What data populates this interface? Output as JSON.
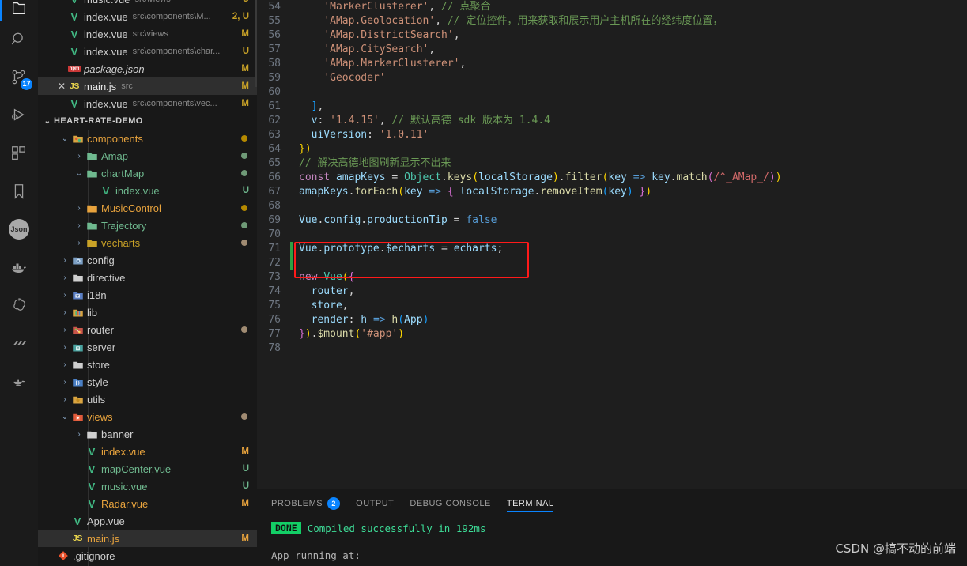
{
  "activitybar": {
    "items": [
      {
        "name": "explorer-icon",
        "label": "Explorer",
        "active": true
      },
      {
        "name": "search-icon",
        "label": "Search"
      },
      {
        "name": "source-control-icon",
        "label": "Source Control",
        "badge": "17"
      },
      {
        "name": "run-debug-icon",
        "label": "Run and Debug"
      },
      {
        "name": "extensions-icon",
        "label": "Extensions"
      },
      {
        "name": "bookmark-icon",
        "label": "Bookmarks"
      },
      {
        "name": "json-icon",
        "label": "Json"
      },
      {
        "name": "docker-icon",
        "label": "Docker"
      },
      {
        "name": "openai-icon",
        "label": "OpenAI"
      },
      {
        "name": "slashes-icon",
        "label": "Todo"
      },
      {
        "name": "lamp-icon",
        "label": "Lamp"
      }
    ]
  },
  "sidebar": {
    "open_editors": [
      {
        "icon": "vue-file-icon",
        "name": "music.vue",
        "path": "src\\views",
        "status": "U",
        "dirty": false,
        "selected": false,
        "partial": true
      },
      {
        "icon": "vue-file-icon",
        "name": "index.vue",
        "path": "src\\components\\M...",
        "status": "2, U",
        "dirty": false,
        "selected": false
      },
      {
        "icon": "vue-file-icon",
        "name": "index.vue",
        "path": "src\\views",
        "status": "M",
        "dirty": false,
        "selected": false
      },
      {
        "icon": "vue-file-icon",
        "name": "index.vue",
        "path": "src\\components\\char...",
        "status": "U",
        "dirty": false,
        "selected": false
      },
      {
        "icon": "npm-file-icon",
        "name": "package.json",
        "path": "",
        "status": "M",
        "dirty": false,
        "selected": false,
        "italic": true
      },
      {
        "icon": "js-file-icon",
        "name": "main.js",
        "path": "src",
        "status": "M",
        "dirty": true,
        "selected": true
      },
      {
        "icon": "vue-file-icon",
        "name": "index.vue",
        "path": "src\\components\\vec...",
        "status": "M",
        "dirty": false,
        "selected": false
      }
    ],
    "project": {
      "label": "HEART-RATE-DEMO",
      "expanded": true
    },
    "tree": [
      {
        "depth": 1,
        "type": "folder",
        "icon": "components-folder-icon",
        "name": "components",
        "expanded": true,
        "dot": "#b58900",
        "color": "#e8a33d"
      },
      {
        "depth": 2,
        "type": "folder",
        "icon": "folder-icon",
        "name": "Amap",
        "expanded": false,
        "dot": "#6f9a77",
        "color": "#6fb98f"
      },
      {
        "depth": 2,
        "type": "folder",
        "icon": "folder-icon",
        "name": "chartMap",
        "expanded": true,
        "dot": "#6f9a77",
        "color": "#6fb98f"
      },
      {
        "depth": 3,
        "type": "file",
        "icon": "vue-file-icon",
        "name": "index.vue",
        "status": "U",
        "color": "#6fb98f"
      },
      {
        "depth": 2,
        "type": "folder",
        "icon": "folder-icon",
        "name": "MusicControl",
        "expanded": false,
        "dot": "#b58900",
        "color": "#e8a33d"
      },
      {
        "depth": 2,
        "type": "folder",
        "icon": "folder-icon",
        "name": "Trajectory",
        "expanded": false,
        "dot": "#6f9a77",
        "color": "#6fb98f"
      },
      {
        "depth": 2,
        "type": "folder",
        "icon": "folder-icon",
        "name": "vecharts",
        "expanded": false,
        "dot": "#a08b72",
        "color": "#c9a227"
      },
      {
        "depth": 1,
        "type": "folder",
        "icon": "config-folder-icon",
        "name": "config",
        "expanded": false,
        "color": "#cfcfcf"
      },
      {
        "depth": 1,
        "type": "folder",
        "icon": "folder-icon",
        "name": "directive",
        "expanded": false,
        "color": "#cfcfcf"
      },
      {
        "depth": 1,
        "type": "folder",
        "icon": "i18n-folder-icon",
        "name": "i18n",
        "expanded": false,
        "color": "#cfcfcf"
      },
      {
        "depth": 1,
        "type": "folder",
        "icon": "lib-folder-icon",
        "name": "lib",
        "expanded": false,
        "color": "#cfcfcf"
      },
      {
        "depth": 1,
        "type": "folder",
        "icon": "router-folder-icon",
        "name": "router",
        "expanded": false,
        "dot": "#a08b72",
        "color": "#cfcfcf"
      },
      {
        "depth": 1,
        "type": "folder",
        "icon": "server-folder-icon",
        "name": "server",
        "expanded": false,
        "color": "#cfcfcf"
      },
      {
        "depth": 1,
        "type": "folder",
        "icon": "folder-icon",
        "name": "store",
        "expanded": false,
        "color": "#cfcfcf"
      },
      {
        "depth": 1,
        "type": "folder",
        "icon": "style-folder-icon",
        "name": "style",
        "expanded": false,
        "color": "#cfcfcf"
      },
      {
        "depth": 1,
        "type": "folder",
        "icon": "utils-folder-icon",
        "name": "utils",
        "expanded": false,
        "color": "#cfcfcf"
      },
      {
        "depth": 1,
        "type": "folder",
        "icon": "views-folder-icon",
        "name": "views",
        "expanded": true,
        "dot": "#a08b72",
        "color": "#e8a33d"
      },
      {
        "depth": 2,
        "type": "folder",
        "icon": "folder-icon",
        "name": "banner",
        "expanded": false,
        "color": "#cfcfcf"
      },
      {
        "depth": 2,
        "type": "file",
        "icon": "vue-file-icon",
        "name": "index.vue",
        "status": "M",
        "color": "#e8a33d"
      },
      {
        "depth": 2,
        "type": "file",
        "icon": "vue-file-icon",
        "name": "mapCenter.vue",
        "status": "U",
        "color": "#6fb98f"
      },
      {
        "depth": 2,
        "type": "file",
        "icon": "vue-file-icon",
        "name": "music.vue",
        "status": "U",
        "color": "#6fb98f"
      },
      {
        "depth": 2,
        "type": "file",
        "icon": "vue-file-icon",
        "name": "Radar.vue",
        "status": "M",
        "color": "#e8a33d"
      },
      {
        "depth": 1,
        "type": "file",
        "icon": "vue-file-icon",
        "name": "App.vue",
        "status": "",
        "color": "#cfcfcf"
      },
      {
        "depth": 1,
        "type": "file",
        "icon": "js-file-icon",
        "name": "main.js",
        "status": "M",
        "color": "#e8a33d",
        "selected": true
      },
      {
        "depth": 0,
        "type": "file",
        "icon": "git-file-icon",
        "name": ".gitignore",
        "status": "",
        "color": "#cfcfcf"
      }
    ]
  },
  "editor": {
    "first_line_number": 54,
    "lines": [
      {
        "n": 54,
        "git": false,
        "tokens": [
          {
            "t": "    ",
            "c": "def"
          },
          {
            "t": "'MarkerClusterer'",
            "c": "str"
          },
          {
            "t": ", ",
            "c": "def"
          },
          {
            "t": "// 点聚合",
            "c": "com"
          }
        ]
      },
      {
        "n": 55,
        "git": false,
        "tokens": [
          {
            "t": "    ",
            "c": "def"
          },
          {
            "t": "'AMap.Geolocation'",
            "c": "str"
          },
          {
            "t": ", ",
            "c": "def"
          },
          {
            "t": "// 定位控件，用来获取和展示用户主机所在的经纬度位置，",
            "c": "com"
          }
        ]
      },
      {
        "n": 56,
        "git": false,
        "tokens": [
          {
            "t": "    ",
            "c": "def"
          },
          {
            "t": "'AMap.DistrictSearch'",
            "c": "str"
          },
          {
            "t": ",",
            "c": "def"
          }
        ]
      },
      {
        "n": 57,
        "git": false,
        "tokens": [
          {
            "t": "    ",
            "c": "def"
          },
          {
            "t": "'AMap.CitySearch'",
            "c": "str"
          },
          {
            "t": ",",
            "c": "def"
          }
        ]
      },
      {
        "n": 58,
        "git": false,
        "tokens": [
          {
            "t": "    ",
            "c": "def"
          },
          {
            "t": "'AMap.MarkerClusterer'",
            "c": "str"
          },
          {
            "t": ",",
            "c": "def"
          }
        ]
      },
      {
        "n": 59,
        "git": false,
        "tokens": [
          {
            "t": "    ",
            "c": "def"
          },
          {
            "t": "'Geocoder'",
            "c": "str"
          }
        ]
      },
      {
        "n": 60,
        "git": false,
        "tokens": []
      },
      {
        "n": 61,
        "git": false,
        "tokens": [
          {
            "t": "  ",
            "c": "def"
          },
          {
            "t": "]",
            "c": "pl3"
          },
          {
            "t": ",",
            "c": "def"
          }
        ]
      },
      {
        "n": 62,
        "git": false,
        "tokens": [
          {
            "t": "  ",
            "c": "def"
          },
          {
            "t": "v",
            "c": "var"
          },
          {
            "t": ": ",
            "c": "def"
          },
          {
            "t": "'1.4.15'",
            "c": "str"
          },
          {
            "t": ", ",
            "c": "def"
          },
          {
            "t": "// 默认高德 sdk 版本为 1.4.4",
            "c": "com"
          }
        ]
      },
      {
        "n": 63,
        "git": false,
        "tokens": [
          {
            "t": "  ",
            "c": "def"
          },
          {
            "t": "uiVersion",
            "c": "var"
          },
          {
            "t": ": ",
            "c": "def"
          },
          {
            "t": "'1.0.11'",
            "c": "str"
          }
        ]
      },
      {
        "n": 64,
        "git": false,
        "tokens": [
          {
            "t": "})",
            "c": "pl"
          }
        ]
      },
      {
        "n": 65,
        "git": false,
        "tokens": [
          {
            "t": "// 解决高德地图刷新显示不出来",
            "c": "com"
          }
        ]
      },
      {
        "n": 66,
        "git": false,
        "tokens": [
          {
            "t": "const",
            "c": "kw2"
          },
          {
            "t": " ",
            "c": "def"
          },
          {
            "t": "amapKeys",
            "c": "var"
          },
          {
            "t": " = ",
            "c": "def"
          },
          {
            "t": "Object",
            "c": "cls"
          },
          {
            "t": ".",
            "c": "def"
          },
          {
            "t": "keys",
            "c": "fn"
          },
          {
            "t": "(",
            "c": "pl"
          },
          {
            "t": "localStorage",
            "c": "var"
          },
          {
            "t": ")",
            "c": "pl"
          },
          {
            "t": ".",
            "c": "def"
          },
          {
            "t": "filter",
            "c": "fn"
          },
          {
            "t": "(",
            "c": "pl"
          },
          {
            "t": "key",
            "c": "var"
          },
          {
            "t": " ",
            "c": "def"
          },
          {
            "t": "=>",
            "c": "blue"
          },
          {
            "t": " ",
            "c": "def"
          },
          {
            "t": "key",
            "c": "var"
          },
          {
            "t": ".",
            "c": "def"
          },
          {
            "t": "match",
            "c": "fn"
          },
          {
            "t": "(",
            "c": "pl2"
          },
          {
            "t": "/^_AMap_/",
            "c": "re"
          },
          {
            "t": ")",
            "c": "pl2"
          },
          {
            "t": ")",
            "c": "pl"
          }
        ]
      },
      {
        "n": 67,
        "git": false,
        "tokens": [
          {
            "t": "amapKeys",
            "c": "var"
          },
          {
            "t": ".",
            "c": "def"
          },
          {
            "t": "forEach",
            "c": "fn"
          },
          {
            "t": "(",
            "c": "pl"
          },
          {
            "t": "key",
            "c": "var"
          },
          {
            "t": " ",
            "c": "def"
          },
          {
            "t": "=>",
            "c": "blue"
          },
          {
            "t": " ",
            "c": "def"
          },
          {
            "t": "{",
            "c": "pl2"
          },
          {
            "t": " ",
            "c": "def"
          },
          {
            "t": "localStorage",
            "c": "var"
          },
          {
            "t": ".",
            "c": "def"
          },
          {
            "t": "removeItem",
            "c": "fn"
          },
          {
            "t": "(",
            "c": "pl3"
          },
          {
            "t": "key",
            "c": "var"
          },
          {
            "t": ")",
            "c": "pl3"
          },
          {
            "t": " ",
            "c": "def"
          },
          {
            "t": "}",
            "c": "pl2"
          },
          {
            "t": ")",
            "c": "pl"
          }
        ]
      },
      {
        "n": 68,
        "git": false,
        "tokens": []
      },
      {
        "n": 69,
        "git": false,
        "tokens": [
          {
            "t": "Vue",
            "c": "var"
          },
          {
            "t": ".",
            "c": "def"
          },
          {
            "t": "config",
            "c": "var"
          },
          {
            "t": ".",
            "c": "def"
          },
          {
            "t": "productionTip",
            "c": "var"
          },
          {
            "t": " = ",
            "c": "def"
          },
          {
            "t": "false",
            "c": "key"
          }
        ]
      },
      {
        "n": 70,
        "git": false,
        "tokens": []
      },
      {
        "n": 71,
        "git": true,
        "tokens": [
          {
            "t": "Vue",
            "c": "var"
          },
          {
            "t": ".",
            "c": "def"
          },
          {
            "t": "prototype",
            "c": "var"
          },
          {
            "t": ".",
            "c": "def"
          },
          {
            "t": "$echarts",
            "c": "var"
          },
          {
            "t": " = ",
            "c": "def"
          },
          {
            "t": "echarts",
            "c": "var"
          },
          {
            "t": ";",
            "c": "def"
          }
        ]
      },
      {
        "n": 72,
        "git": true,
        "tokens": []
      },
      {
        "n": 73,
        "git": false,
        "tokens": [
          {
            "t": "new",
            "c": "kw2"
          },
          {
            "t": " ",
            "c": "def"
          },
          {
            "t": "Vue",
            "c": "cls"
          },
          {
            "t": "(",
            "c": "pl"
          },
          {
            "t": "{",
            "c": "pl2"
          }
        ]
      },
      {
        "n": 74,
        "git": false,
        "tokens": [
          {
            "t": "  ",
            "c": "def"
          },
          {
            "t": "router",
            "c": "var"
          },
          {
            "t": ",",
            "c": "def"
          }
        ]
      },
      {
        "n": 75,
        "git": false,
        "tokens": [
          {
            "t": "  ",
            "c": "def"
          },
          {
            "t": "store",
            "c": "var"
          },
          {
            "t": ",",
            "c": "def"
          }
        ]
      },
      {
        "n": 76,
        "git": false,
        "tokens": [
          {
            "t": "  ",
            "c": "def"
          },
          {
            "t": "render",
            "c": "var"
          },
          {
            "t": ": ",
            "c": "def"
          },
          {
            "t": "h",
            "c": "var"
          },
          {
            "t": " ",
            "c": "def"
          },
          {
            "t": "=>",
            "c": "blue"
          },
          {
            "t": " ",
            "c": "def"
          },
          {
            "t": "h",
            "c": "fn"
          },
          {
            "t": "(",
            "c": "pl3"
          },
          {
            "t": "App",
            "c": "var"
          },
          {
            "t": ")",
            "c": "pl3"
          }
        ]
      },
      {
        "n": 77,
        "git": false,
        "tokens": [
          {
            "t": "}",
            "c": "pl2"
          },
          {
            "t": ")",
            "c": "pl"
          },
          {
            "t": ".",
            "c": "def"
          },
          {
            "t": "$mount",
            "c": "fn"
          },
          {
            "t": "(",
            "c": "pl"
          },
          {
            "t": "'#app'",
            "c": "str"
          },
          {
            "t": ")",
            "c": "pl"
          }
        ]
      },
      {
        "n": 78,
        "git": false,
        "tokens": []
      }
    ],
    "annotation": {
      "color": "#ff1a1a",
      "target_line": 71
    }
  },
  "panel": {
    "tabs": [
      {
        "label": "PROBLEMS",
        "badge": "2",
        "active": false
      },
      {
        "label": "OUTPUT",
        "badge": "",
        "active": false
      },
      {
        "label": "DEBUG CONSOLE",
        "badge": "",
        "active": false
      },
      {
        "label": "TERMINAL",
        "badge": "",
        "active": true
      }
    ],
    "terminal": {
      "badge": "DONE",
      "message": "Compiled successfully in 192ms",
      "next_line": "App running at:"
    }
  },
  "watermark": "CSDN @搞不动的前端"
}
